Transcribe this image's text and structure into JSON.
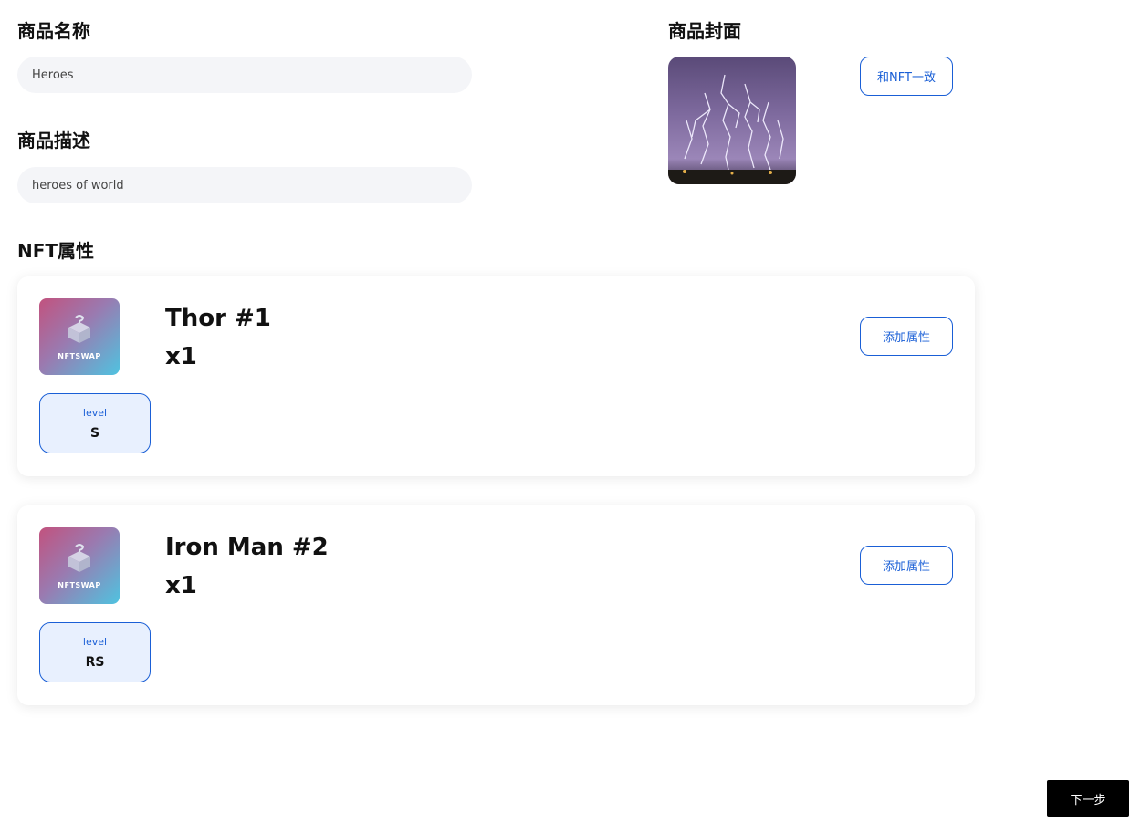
{
  "form": {
    "name_label": "商品名称",
    "name_value": "Heroes",
    "desc_label": "商品描述",
    "desc_value": "heroes of world",
    "cover_label": "商品封面",
    "same_as_nft_label": "和NFT一致",
    "attributes_label": "NFT属性"
  },
  "nfts": [
    {
      "name": "Thor #1",
      "quantity": "x1",
      "thumb_brand": "NFTSWAP",
      "add_attr_label": "添加属性",
      "attributes": [
        {
          "key": "level",
          "value": "S"
        }
      ]
    },
    {
      "name": "Iron Man #2",
      "quantity": "x1",
      "thumb_brand": "NFTSWAP",
      "add_attr_label": "添加属性",
      "attributes": [
        {
          "key": "level",
          "value": "RS"
        }
      ]
    }
  ],
  "footer": {
    "next_label": "下一步"
  },
  "colors": {
    "accent": "#1a5fd6",
    "chip_bg": "#e8f0fe",
    "input_bg": "#f4f5f8",
    "primary_button": "#000000"
  },
  "icons": {
    "nft_placeholder": "mystery-box-icon",
    "cover_image": "lightning-storm-image"
  }
}
